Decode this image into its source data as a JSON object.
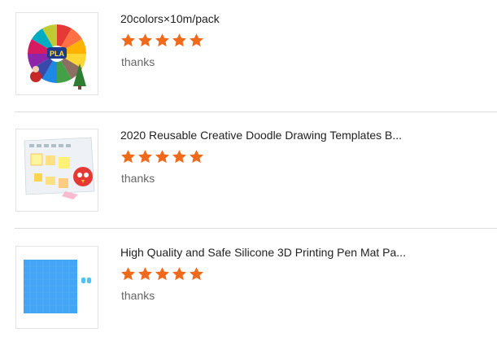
{
  "reviews": [
    {
      "title": "20colors×10m/pack",
      "rating": 5,
      "comment": "thanks",
      "thumb_icon": "pla-filament-pack-image"
    },
    {
      "title": "2020 Reusable Creative Doodle Drawing Templates B...",
      "rating": 5,
      "comment": "thanks",
      "thumb_icon": "doodle-templates-image"
    },
    {
      "title": "High Quality and Safe Silicone 3D Printing Pen Mat Pa...",
      "rating": 5,
      "comment": "thanks",
      "thumb_icon": "silicone-mat-image"
    }
  ],
  "colors": {
    "star": "#f06a1b",
    "divider": "#dcdcdc",
    "title_text": "#222222",
    "comment_text": "#666666"
  }
}
